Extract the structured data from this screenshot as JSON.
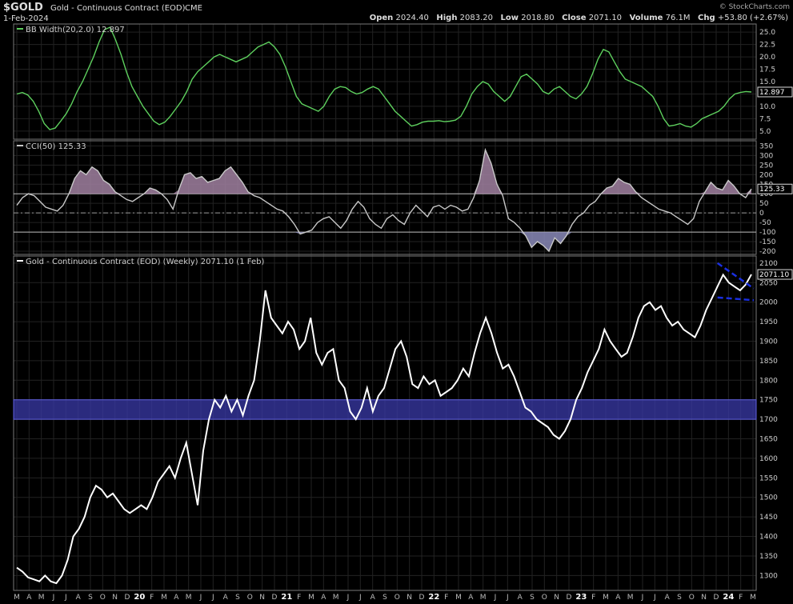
{
  "header": {
    "symbol": "$GOLD",
    "name": "Gold - Continuous Contract (EOD)",
    "exchange": "CME",
    "date": "1-Feb-2024",
    "watermark": "© StockCharts.com",
    "open_label": "Open",
    "open": "2024.40",
    "high_label": "High",
    "high": "2083.20",
    "low_label": "Low",
    "low": "2018.80",
    "close_label": "Close",
    "close": "2071.10",
    "volume_label": "Volume",
    "volume": "76.1M",
    "chg_label": "Chg",
    "chg": "+53.80 (+2.67%)"
  },
  "colors": {
    "bb": "#5ed05e",
    "cci": "#c8c8c8",
    "cci_fill": "#a080a0",
    "price": "#ffffff",
    "band": "#3a3aa8",
    "trend": "#1a2fe0",
    "grid": "#222222"
  },
  "chart_data": [
    {
      "type": "line",
      "title": "BB Width(20,2.0) 12.897",
      "last_value": "12.897",
      "ylim": [
        4,
        26
      ],
      "yticks": [
        "25.0",
        "22.5",
        "20.0",
        "17.5",
        "15.0",
        "12.5",
        "10.0",
        "7.5",
        "5.0"
      ],
      "values": [
        12.5,
        12.8,
        12.3,
        11.0,
        9.0,
        6.5,
        5.3,
        5.6,
        7.0,
        8.5,
        10.5,
        13.0,
        15.0,
        17.5,
        20.0,
        23.0,
        25.5,
        26.0,
        23.5,
        20.5,
        17.0,
        14.0,
        12.0,
        10.0,
        8.5,
        7.0,
        6.3,
        6.8,
        8.0,
        9.5,
        11.0,
        13.0,
        15.5,
        17.0,
        18.0,
        19.0,
        20.0,
        20.5,
        20.0,
        19.5,
        19.0,
        19.5,
        20.0,
        21.0,
        22.0,
        22.5,
        23.0,
        22.0,
        20.5,
        18.0,
        15.0,
        12.0,
        10.5,
        10.0,
        9.5,
        9.0,
        10.0,
        12.0,
        13.5,
        14.0,
        13.8,
        13.0,
        12.5,
        12.8,
        13.5,
        14.0,
        13.5,
        12.0,
        10.5,
        9.0,
        8.0,
        7.0,
        6.0,
        6.3,
        6.8,
        7.0,
        7.0,
        7.1,
        6.9,
        7.0,
        7.2,
        8.0,
        10.0,
        12.5,
        14.0,
        15.0,
        14.5,
        13.0,
        12.0,
        11.0,
        12.0,
        14.0,
        16.0,
        16.5,
        15.5,
        14.5,
        13.0,
        12.5,
        13.5,
        14.0,
        13.0,
        12.0,
        11.5,
        12.5,
        14.0,
        16.5,
        19.5,
        21.5,
        21.0,
        19.0,
        17.0,
        15.5,
        15.0,
        14.5,
        14.0,
        13.0,
        12.0,
        10.0,
        7.5,
        6.0,
        6.2,
        6.5,
        6.0,
        5.8,
        6.5,
        7.5,
        8.0,
        8.5,
        9.0,
        10.0,
        11.5,
        12.5,
        12.8,
        13.0,
        12.9
      ]
    },
    {
      "type": "line",
      "title": "CCI(50) 125.33",
      "last_value": "125.33",
      "ylim": [
        -200,
        360
      ],
      "yticks": [
        "350",
        "300",
        "250",
        "200",
        "150",
        "100",
        "50",
        "0",
        "-50",
        "-100",
        "-150",
        "-200"
      ],
      "values": [
        40,
        80,
        100,
        90,
        60,
        30,
        20,
        10,
        40,
        100,
        180,
        220,
        200,
        240,
        220,
        170,
        150,
        110,
        90,
        70,
        60,
        80,
        100,
        130,
        120,
        100,
        70,
        20,
        120,
        200,
        210,
        180,
        190,
        160,
        170,
        180,
        220,
        240,
        200,
        160,
        110,
        90,
        80,
        60,
        40,
        20,
        10,
        -20,
        -60,
        -110,
        -100,
        -90,
        -50,
        -30,
        -20,
        -50,
        -80,
        -40,
        20,
        60,
        30,
        -30,
        -60,
        -80,
        -30,
        -10,
        -40,
        -60,
        0,
        40,
        10,
        -20,
        30,
        40,
        20,
        40,
        30,
        10,
        20,
        80,
        170,
        330,
        260,
        150,
        90,
        -30,
        -50,
        -80,
        -120,
        -180,
        -150,
        -170,
        -200,
        -130,
        -160,
        -120,
        -60,
        -20,
        0,
        40,
        60,
        100,
        130,
        140,
        180,
        160,
        150,
        110,
        80,
        60,
        40,
        20,
        10,
        0,
        -20,
        -40,
        -60,
        -30,
        60,
        110,
        160,
        130,
        120,
        170,
        140,
        100,
        80,
        125
      ]
    },
    {
      "type": "line",
      "title": "Gold - Continuous Contract (EOD) (Weekly) 2071.10 (1 Feb)",
      "last_value": "2071.10",
      "ylim": [
        1270,
        2110
      ],
      "yticks": [
        "2100",
        "2050",
        "2000",
        "1950",
        "1900",
        "1850",
        "1800",
        "1750",
        "1700",
        "1650",
        "1600",
        "1550",
        "1500",
        "1450",
        "1400",
        "1350",
        "1300"
      ],
      "x": [
        "M",
        "A",
        "M",
        "J",
        "J",
        "A",
        "S",
        "O",
        "N",
        "D",
        "20",
        "F",
        "M",
        "A",
        "M",
        "J",
        "J",
        "A",
        "S",
        "O",
        "N",
        "D",
        "21",
        "F",
        "M",
        "A",
        "M",
        "J",
        "J",
        "A",
        "S",
        "O",
        "N",
        "D",
        "22",
        "F",
        "M",
        "A",
        "M",
        "J",
        "J",
        "A",
        "S",
        "O",
        "N",
        "D",
        "23",
        "F",
        "M",
        "A",
        "M",
        "J",
        "J",
        "A",
        "S",
        "O",
        "N",
        "D",
        "24",
        "F",
        "M"
      ],
      "values": [
        1320,
        1310,
        1295,
        1290,
        1285,
        1300,
        1285,
        1280,
        1300,
        1340,
        1400,
        1420,
        1450,
        1500,
        1530,
        1520,
        1500,
        1510,
        1490,
        1470,
        1460,
        1470,
        1480,
        1470,
        1500,
        1540,
        1560,
        1580,
        1550,
        1600,
        1640,
        1560,
        1480,
        1620,
        1700,
        1750,
        1730,
        1760,
        1720,
        1750,
        1710,
        1760,
        1800,
        1900,
        2030,
        1960,
        1940,
        1920,
        1950,
        1930,
        1880,
        1900,
        1960,
        1870,
        1840,
        1870,
        1880,
        1800,
        1780,
        1720,
        1700,
        1730,
        1780,
        1720,
        1760,
        1780,
        1830,
        1880,
        1900,
        1860,
        1790,
        1780,
        1810,
        1790,
        1800,
        1760,
        1770,
        1780,
        1800,
        1830,
        1810,
        1870,
        1920,
        1960,
        1920,
        1870,
        1830,
        1840,
        1810,
        1770,
        1730,
        1720,
        1700,
        1690,
        1680,
        1660,
        1650,
        1670,
        1700,
        1750,
        1780,
        1820,
        1850,
        1880,
        1930,
        1900,
        1880,
        1860,
        1870,
        1910,
        1960,
        1990,
        2000,
        1980,
        1990,
        1960,
        1940,
        1950,
        1930,
        1920,
        1910,
        1940,
        1980,
        2010,
        2040,
        2070,
        2050,
        2040,
        2030,
        2045,
        2071
      ]
    }
  ],
  "x_axis": [
    "M",
    "A",
    "M",
    "J",
    "J",
    "A",
    "S",
    "O",
    "N",
    "D",
    "20",
    "F",
    "M",
    "A",
    "M",
    "J",
    "J",
    "A",
    "S",
    "O",
    "N",
    "D",
    "21",
    "F",
    "M",
    "A",
    "M",
    "J",
    "J",
    "A",
    "S",
    "O",
    "N",
    "D",
    "22",
    "F",
    "M",
    "A",
    "M",
    "J",
    "J",
    "A",
    "S",
    "O",
    "N",
    "D",
    "23",
    "F",
    "M",
    "A",
    "M",
    "J",
    "J",
    "A",
    "S",
    "O",
    "N",
    "D",
    "24",
    "F",
    "M"
  ],
  "support_band": [
    1700,
    1750
  ]
}
